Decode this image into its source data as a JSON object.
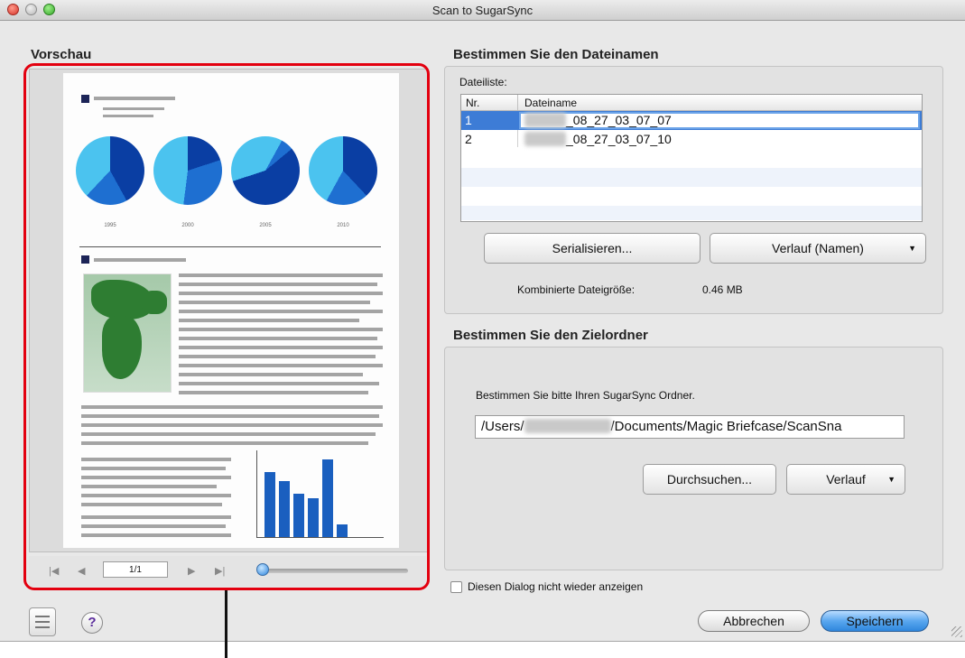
{
  "window": {
    "title": "Scan to SugarSync"
  },
  "preview": {
    "title": "Vorschau",
    "page_indicator": "1/1",
    "zoom_level": 0.0,
    "years": [
      "1995",
      "2000",
      "2005",
      "2010"
    ],
    "bar_values": [
      75,
      65,
      50,
      45,
      90,
      15
    ]
  },
  "filename_section": {
    "title": "Bestimmen Sie den Dateinamen",
    "list_label": "Dateiliste:",
    "columns": [
      "Nr.",
      "Dateiname"
    ],
    "rows": [
      {
        "nr": "1",
        "name": "_08_27_03_07_07",
        "selected": true
      },
      {
        "nr": "2",
        "name": "_08_27_03_07_10",
        "selected": false
      }
    ],
    "serialize_button": "Serialisieren...",
    "history_button": "Verlauf (Namen)",
    "combined_size_label": "Kombinierte Dateigröße:",
    "combined_size_value": "0.46  MB"
  },
  "folder_section": {
    "title": "Bestimmen Sie den Zielordner",
    "prompt": "Bestimmen Sie bitte Ihren SugarSync Ordner.",
    "path_prefix": "/Users/",
    "path_suffix": "/Documents/Magic Briefcase/ScanSna",
    "browse_button": "Durchsuchen...",
    "history_button": "Verlauf"
  },
  "dont_show_again": "Diesen Dialog nicht wieder anzeigen",
  "help_symbol": "?",
  "footer": {
    "cancel_button": "Abbrechen",
    "save_button": "Speichern"
  },
  "colors": {
    "highlight": "#3d7cd6",
    "callout": "#e3000f",
    "primary_button": "#2f86dd"
  }
}
